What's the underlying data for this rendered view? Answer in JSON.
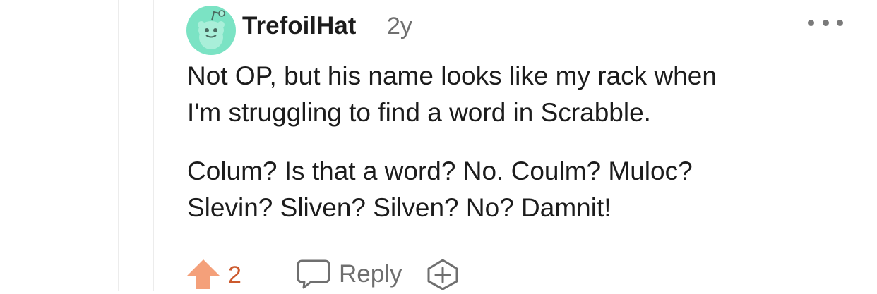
{
  "comment": {
    "author": "TrefoilHat",
    "age": "2y",
    "paragraphs": [
      "Not OP, but his name looks like my rack when",
      "I'm struggling to find a word in Scrabble.",
      "Colum? Is that a word? No. Coulm? Muloc?",
      "Slevin? Sliven? Silven? No? Damnit!"
    ],
    "score": "2",
    "reply_label": "Reply"
  },
  "icons": {
    "avatar": "reddit-snoo-avatar-icon",
    "more": "more-options-icon",
    "upvote": "upvote-arrow-icon",
    "reply": "speech-bubble-icon",
    "award": "award-plus-icon"
  },
  "colors": {
    "avatar_bg": "#7be3c4",
    "upvote_active": "#f4a07a",
    "score": "#cc5a2e",
    "muted_text": "#6f6f6f",
    "body_text": "#1c1c1c"
  }
}
